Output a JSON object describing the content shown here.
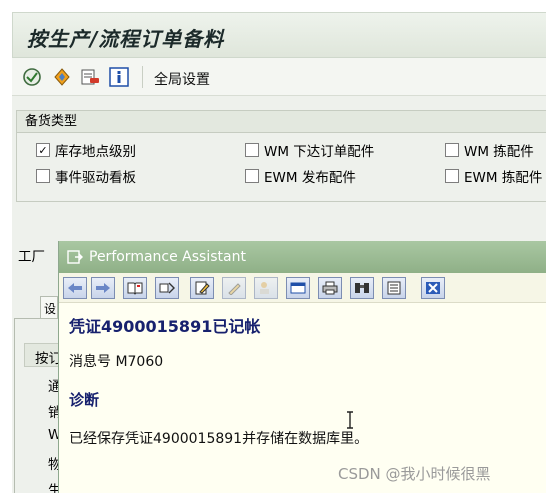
{
  "window": {
    "title": "按生产/流程订单备料"
  },
  "toolbar": {
    "icons": [
      "execute-icon",
      "diamond-icon",
      "delete-list-icon",
      "info-icon"
    ],
    "global_settings_label": "全局设置"
  },
  "stock_type_group": {
    "title": "备货类型",
    "options": [
      {
        "label": "库存地点级别",
        "checked": true
      },
      {
        "label": "WM 下达订单配件",
        "checked": false
      },
      {
        "label": "WM 拣配件",
        "checked": false
      },
      {
        "label": "事件驱动看板",
        "checked": false
      },
      {
        "label": "EWM 发布配件",
        "checked": false
      },
      {
        "label": "EWM 拣配件",
        "checked": false
      }
    ]
  },
  "background": {
    "plant_label": "工厂",
    "tab_stub": "设",
    "inner_head": "按订",
    "inner_items": [
      "通",
      "销",
      "W",
      "物",
      "生"
    ]
  },
  "performance_assistant": {
    "title": "Performance Assistant",
    "heading": "凭证4900015891已记帐",
    "message_no": "消息号 M7060",
    "diagnosis_label": "诊断",
    "diagnosis_text": "已经保存凭证4900015891并存储在数据库里。"
  },
  "watermark": "CSDN @我小时候很黑"
}
